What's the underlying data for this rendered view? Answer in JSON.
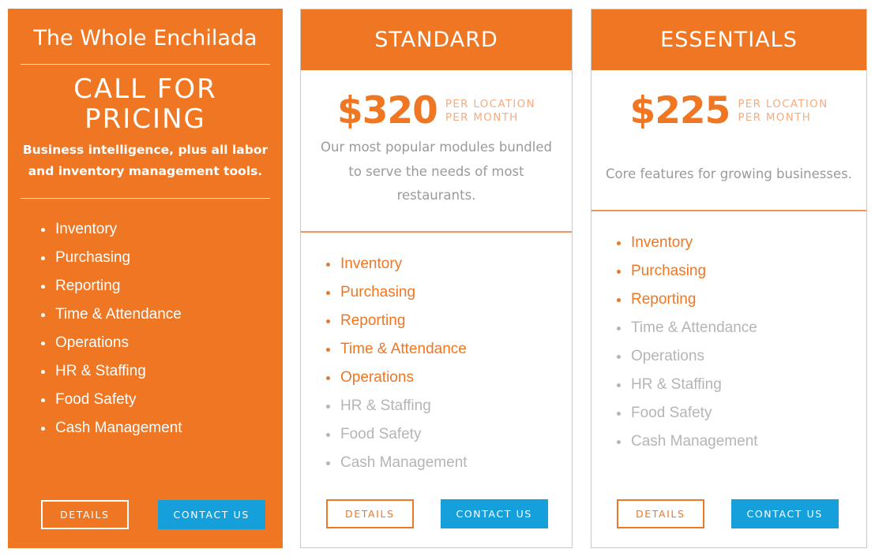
{
  "colors": {
    "orange": "#ef7622",
    "orange_light": "#f8ab7c",
    "orange_divider": "#f3935a",
    "blue": "#16a0db",
    "gray_text": "#9a9a9a",
    "gray_muted": "#b5b5b5",
    "white": "#ffffff",
    "card_border": "#c9c9c9"
  },
  "plans": [
    {
      "id": "whole-enchilada",
      "title": "The Whole Enchilada",
      "price_callout": "CALL FOR PRICING",
      "description": "Business intelligence, plus all labor and inventory management tools.",
      "features": [
        {
          "label": "Inventory",
          "included": true
        },
        {
          "label": "Purchasing",
          "included": true
        },
        {
          "label": "Reporting",
          "included": true
        },
        {
          "label": "Time & Attendance",
          "included": true
        },
        {
          "label": "Operations",
          "included": true
        },
        {
          "label": "HR & Staffing",
          "included": true
        },
        {
          "label": "Food Safety",
          "included": true
        },
        {
          "label": "Cash Management",
          "included": true
        }
      ],
      "details_label": "DETAILS",
      "contact_label": "CONTACT US"
    },
    {
      "id": "standard",
      "title": "STANDARD",
      "price": "$320",
      "price_unit": "PER LOCATION\nPER MONTH",
      "description": "Our most popular modules bundled to serve the needs of most restaurants.",
      "features": [
        {
          "label": "Inventory",
          "included": true
        },
        {
          "label": "Purchasing",
          "included": true
        },
        {
          "label": "Reporting",
          "included": true
        },
        {
          "label": "Time & Attendance",
          "included": true
        },
        {
          "label": "Operations",
          "included": true
        },
        {
          "label": "HR & Staffing",
          "included": false
        },
        {
          "label": "Food Safety",
          "included": false
        },
        {
          "label": "Cash Management",
          "included": false
        }
      ],
      "details_label": "DETAILS",
      "contact_label": "CONTACT US"
    },
    {
      "id": "essentials",
      "title": "ESSENTIALS",
      "price": "$225",
      "price_unit": "PER LOCATION\nPER MONTH",
      "description": "Core features for growing businesses.",
      "features": [
        {
          "label": "Inventory",
          "included": true
        },
        {
          "label": "Purchasing",
          "included": true
        },
        {
          "label": "Reporting",
          "included": true
        },
        {
          "label": "Time & Attendance",
          "included": false
        },
        {
          "label": "Operations",
          "included": false
        },
        {
          "label": "HR & Staffing",
          "included": false
        },
        {
          "label": "Food Safety",
          "included": false
        },
        {
          "label": "Cash Management",
          "included": false
        }
      ],
      "details_label": "DETAILS",
      "contact_label": "CONTACT US"
    }
  ]
}
